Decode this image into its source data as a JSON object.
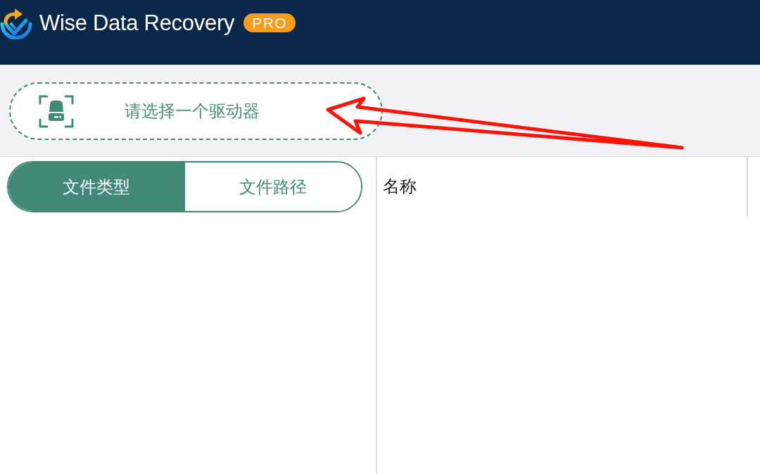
{
  "header": {
    "app_name": "Wise Data Recovery",
    "badge": "PRO"
  },
  "drive_selector": {
    "label": "请选择一个驱动器"
  },
  "view_tabs": [
    {
      "label": "文件类型",
      "selected": true
    },
    {
      "label": "文件路径",
      "selected": false
    }
  ],
  "table": {
    "columns": [
      "名称"
    ]
  }
}
